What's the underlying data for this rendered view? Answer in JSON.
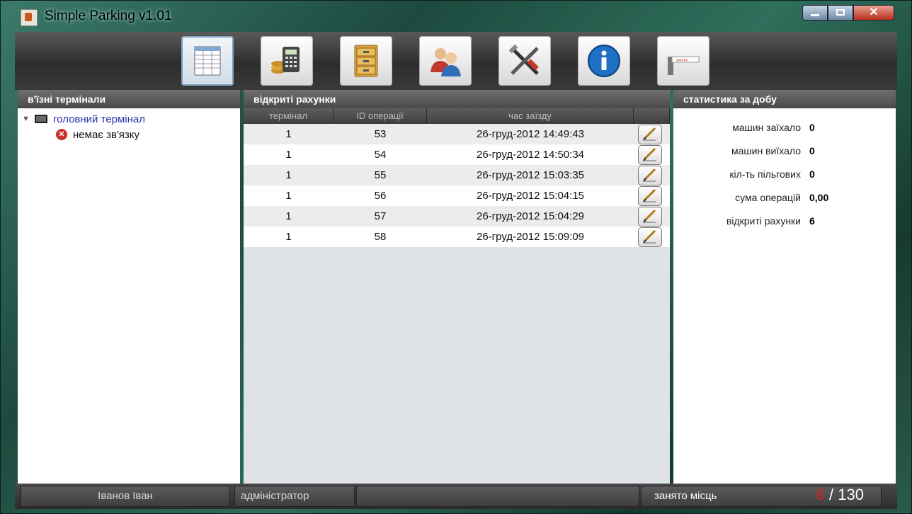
{
  "window": {
    "title": "Simple Parking v1.01"
  },
  "toolbar": {
    "buttons": [
      {
        "name": "accounts",
        "icon": "document-table-icon",
        "active": true
      },
      {
        "name": "cashier",
        "icon": "calculator-coins-icon"
      },
      {
        "name": "archive",
        "icon": "file-cabinet-icon"
      },
      {
        "name": "users",
        "icon": "users-icon"
      },
      {
        "name": "settings",
        "icon": "tools-icon"
      },
      {
        "name": "about",
        "icon": "info-icon"
      },
      {
        "name": "exit",
        "icon": "exit-barrier-icon"
      }
    ]
  },
  "left_panel": {
    "title": "в'їзні термінали",
    "tree": {
      "root_label": "головний термінал",
      "child_label": "немає зв'язку"
    }
  },
  "mid_panel": {
    "title": "відкриті рахунки",
    "columns": [
      "термінал",
      "ID операції",
      "час заїзду"
    ],
    "rows": [
      [
        "1",
        "53",
        "26-груд-2012 14:49:43"
      ],
      [
        "1",
        "54",
        "26-груд-2012 14:50:34"
      ],
      [
        "1",
        "55",
        "26-груд-2012 15:03:35"
      ],
      [
        "1",
        "56",
        "26-груд-2012 15:04:15"
      ],
      [
        "1",
        "57",
        "26-груд-2012 15:04:29"
      ],
      [
        "1",
        "58",
        "26-груд-2012 15:09:09"
      ]
    ]
  },
  "right_panel": {
    "title": "статистика за добу",
    "stats": [
      {
        "label": "машин заїхало",
        "value": "0"
      },
      {
        "label": "машин виїхало",
        "value": "0"
      },
      {
        "label": "кіл-ть пільгових",
        "value": "0"
      },
      {
        "label": "сума операцій",
        "value": "0,00"
      },
      {
        "label": "відкриті рахунки",
        "value": "6"
      }
    ]
  },
  "statusbar": {
    "user": "Іванов Іван",
    "role": "адміністратор",
    "places_label": "занято місць",
    "occupied": "6",
    "separator": " / ",
    "total": "130"
  },
  "colors": {
    "accent_red": "#e02020",
    "link_blue": "#2a33a8"
  }
}
